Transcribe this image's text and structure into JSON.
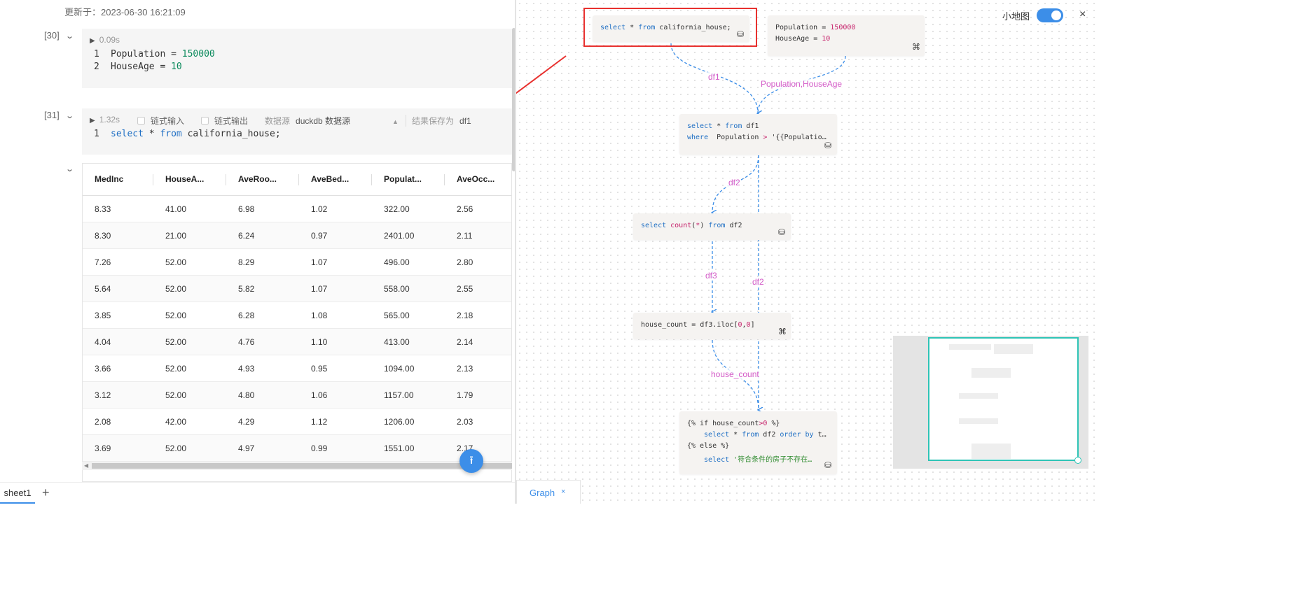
{
  "notebook": {
    "updated_at": "更新于：2023-06-30 16:21:09",
    "cell30": {
      "number": "[30]",
      "run_time": "0.09s",
      "lines": [
        {
          "n": "1",
          "var": "Population",
          "op": " = ",
          "val": "150000"
        },
        {
          "n": "2",
          "var": "HouseAge",
          "op": " = ",
          "val": "10"
        }
      ]
    },
    "cell31": {
      "number": "[31]",
      "run_time": "1.32s",
      "chain_input": "链式输入",
      "chain_output": "链式输出",
      "datasource_label": "数据源",
      "datasource_value": "duckdb 数据源",
      "save_label": "结果保存为",
      "save_value": "df1",
      "line_no": "1",
      "code_kw1": "select",
      "code_mid": " * ",
      "code_kw2": "from",
      "code_rest": " california_house;"
    },
    "table": {
      "columns": [
        "MedInc",
        "HouseA...",
        "AveRoo...",
        "AveBed...",
        "Populat...",
        "AveOcc..."
      ],
      "rows": [
        [
          "8.33",
          "41.00",
          "6.98",
          "1.02",
          "322.00",
          "2.56"
        ],
        [
          "8.30",
          "21.00",
          "6.24",
          "0.97",
          "2401.00",
          "2.11"
        ],
        [
          "7.26",
          "52.00",
          "8.29",
          "1.07",
          "496.00",
          "2.80"
        ],
        [
          "5.64",
          "52.00",
          "5.82",
          "1.07",
          "558.00",
          "2.55"
        ],
        [
          "3.85",
          "52.00",
          "6.28",
          "1.08",
          "565.00",
          "2.18"
        ],
        [
          "4.04",
          "52.00",
          "4.76",
          "1.10",
          "413.00",
          "2.14"
        ],
        [
          "3.66",
          "52.00",
          "4.93",
          "0.95",
          "1094.00",
          "2.13"
        ],
        [
          "3.12",
          "52.00",
          "4.80",
          "1.06",
          "1157.00",
          "1.79"
        ],
        [
          "2.08",
          "42.00",
          "4.29",
          "1.12",
          "1206.00",
          "2.03"
        ],
        [
          "3.69",
          "52.00",
          "4.97",
          "0.99",
          "1551.00",
          "2.17"
        ]
      ]
    },
    "sheet_tab": "sheet1",
    "add_sheet": "+"
  },
  "graph": {
    "minimap_label": "小地图",
    "minimap_enabled": true,
    "close": "×",
    "tab_label": "Graph",
    "tab_close": "×",
    "nodes": {
      "n1": {
        "kw1": "select",
        "mid": " * ",
        "kw2": "from",
        "rest": " california_house;"
      },
      "n2": {
        "l1_var": "Population",
        "l1_op": " = ",
        "l1_val": "150000",
        "l2_var": "HouseAge",
        "l2_op": " = ",
        "l2_val": "10"
      },
      "n3": {
        "l1_kw1": "select",
        "l1_mid": " * ",
        "l1_kw2": "from",
        "l1_rest": " df1",
        "l2_kw": "where",
        "l2_rest": "  Population ",
        "l2_op": ">",
        "l2_tail": " '{{Populatio…"
      },
      "n4": {
        "kw1": "select",
        "fn": " count",
        "paren1": "(",
        "star": "*",
        "paren2": ") ",
        "kw2": "from",
        "rest": " df2"
      },
      "n5": {
        "var": "house_count = df3.iloc",
        "b1": "[",
        "v1": "0",
        "c": ",",
        "v2": "0",
        "b2": "]"
      },
      "n6": {
        "l1": "{% if house_count",
        "l1_op": ">",
        "l1_val": "0",
        "l1_end": " %}",
        "l2_kw1": "select",
        "l2_mid": " * ",
        "l2_kw2": "from",
        "l2_rest": " df2 ",
        "l2_kw3": "order by",
        "l2_tail": " t…",
        "l3": "{% else %}",
        "l4_kw": "select",
        "l4_str": " '符合条件的房子不存在…"
      }
    },
    "edge_labels": [
      "df1",
      "Population,HouseAge",
      "df2",
      "df3",
      "df2",
      "house_count"
    ],
    "colors": {
      "accent": "#3c8ee8",
      "edge": "#3c8ee8",
      "edge_label": "#d35bc7",
      "highlight": "#e8312f",
      "minimap_view": "#2ec4b6"
    }
  }
}
